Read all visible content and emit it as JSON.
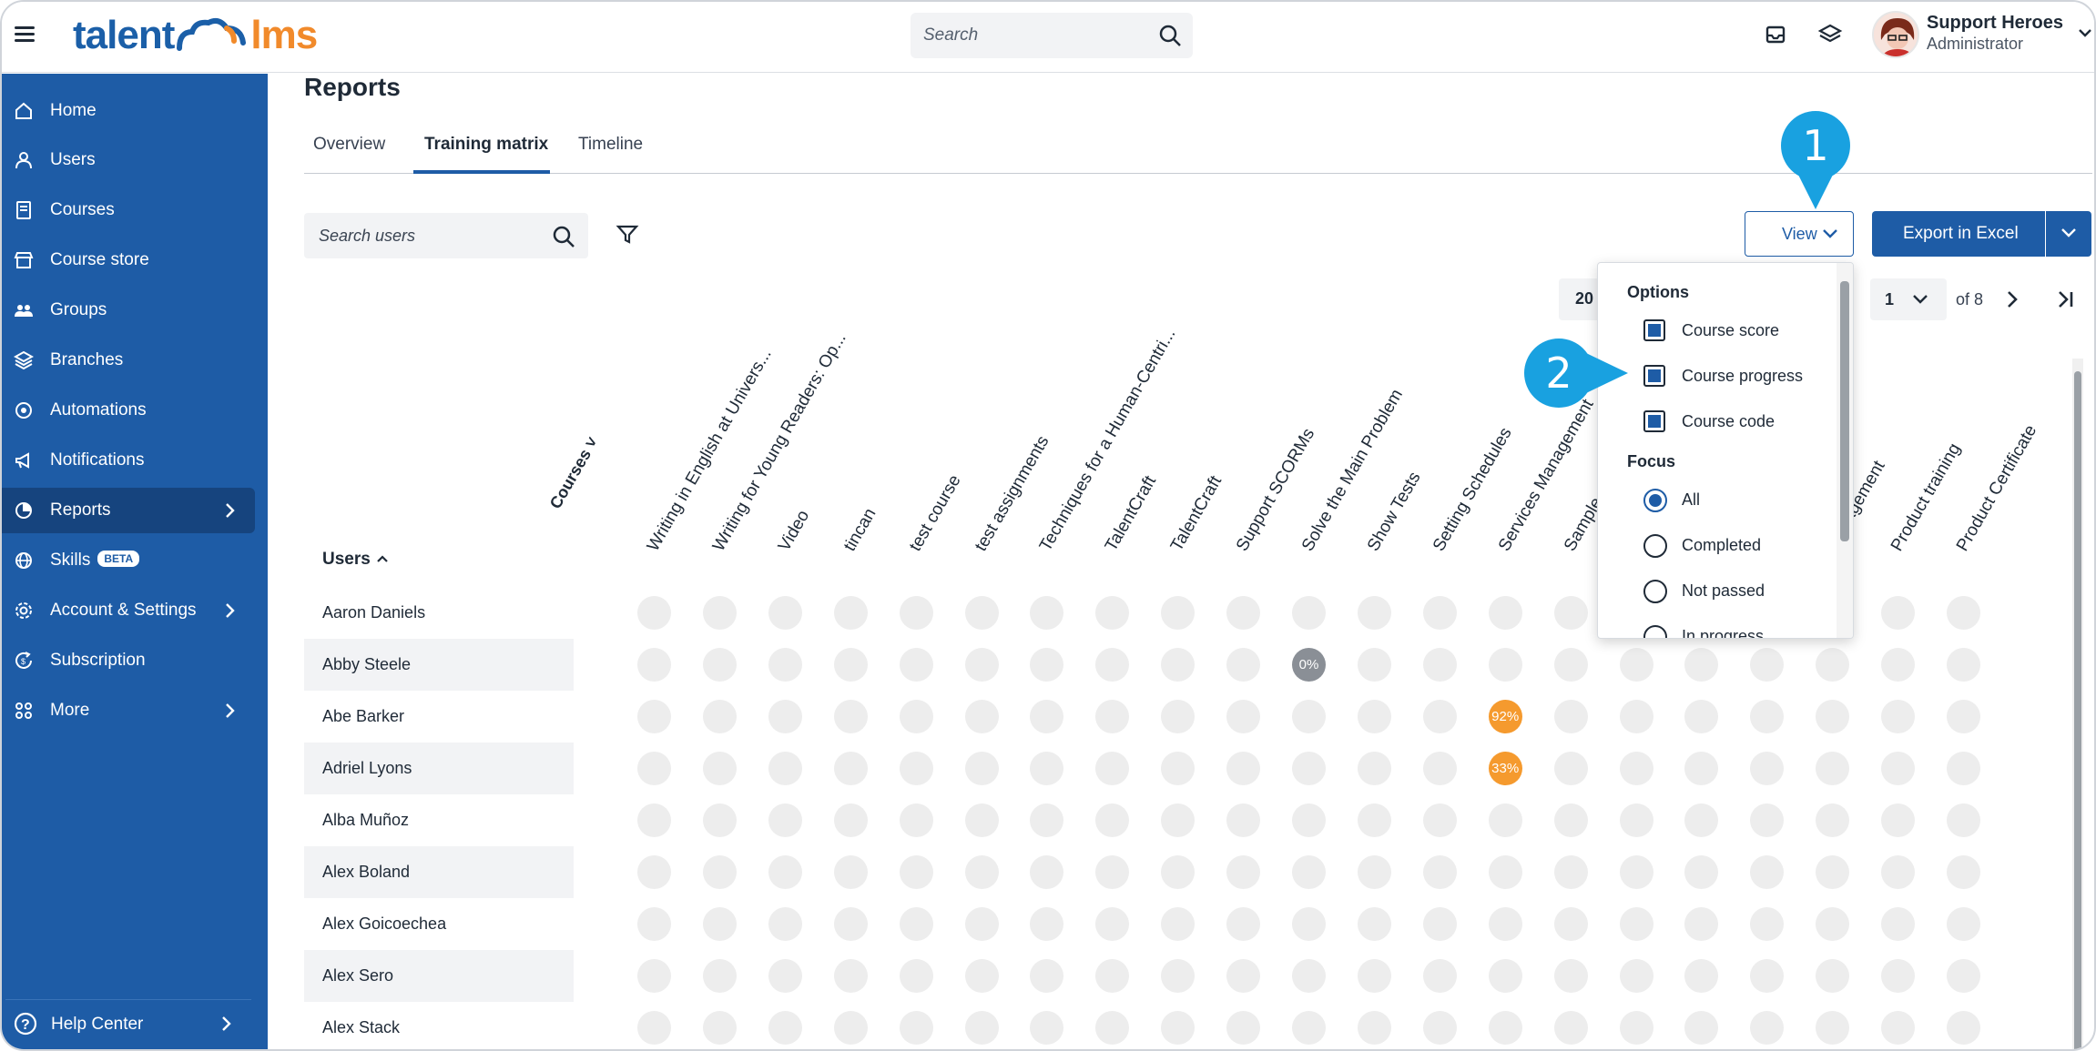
{
  "header": {
    "logo_left": "talent",
    "logo_right": "lms",
    "search_placeholder": "Search",
    "user_name": "Support Heroes",
    "user_role": "Administrator"
  },
  "sidebar": {
    "items": [
      {
        "label": "Home",
        "icon": "home-icon"
      },
      {
        "label": "Users",
        "icon": "user-icon"
      },
      {
        "label": "Courses",
        "icon": "book-icon"
      },
      {
        "label": "Course store",
        "icon": "store-icon"
      },
      {
        "label": "Groups",
        "icon": "groups-icon"
      },
      {
        "label": "Branches",
        "icon": "layers-icon"
      },
      {
        "label": "Automations",
        "icon": "automation-icon"
      },
      {
        "label": "Notifications",
        "icon": "megaphone-icon"
      },
      {
        "label": "Reports",
        "icon": "pie-chart-icon"
      },
      {
        "label": "Skills",
        "icon": "globe-icon"
      },
      {
        "label": "Account & Settings",
        "icon": "gear-icon"
      },
      {
        "label": "Subscription",
        "icon": "subscription-icon"
      },
      {
        "label": "More",
        "icon": "grid-icon"
      }
    ],
    "skills_badge": "BETA",
    "help_label": "Help Center"
  },
  "page": {
    "title": "Reports",
    "tabs": [
      "Overview",
      "Training matrix",
      "Timeline"
    ],
    "active_tab": "Training matrix",
    "search_users_placeholder": "Search users",
    "view_label": "View",
    "export_label": "Export in Excel",
    "per_page": "20",
    "current_page": "1",
    "of_pages": "of 8"
  },
  "matrix": {
    "courses_axis": "Courses",
    "users_header": "Users",
    "courses": [
      "Writing in English at Univers...",
      "Writing for Young Readers: Op...",
      "Video",
      "tincan",
      "test course",
      "test assignments",
      "Techniques for a Human-Centri...",
      "TalentCraft",
      "TalentCraft",
      "Support SCORMs",
      "Solve the Main Problem",
      "Show Tests",
      "Setting Schedules",
      "Services Management",
      "Sample",
      "",
      "",
      "",
      "Management",
      "Product training",
      "Product Certificate"
    ],
    "users": [
      "Aaron Daniels",
      "Abby Steele",
      "Abe Barker",
      "Adriel Lyons",
      "Alba Muñoz",
      "Alex Boland",
      "Alex Goicoechea",
      "Alex Sero",
      "Alex Stack"
    ],
    "highlights": [
      {
        "row": 1,
        "col": 10,
        "text": "0%",
        "color": "#8a8f96"
      },
      {
        "row": 2,
        "col": 13,
        "text": "92%",
        "color": "#f59a2e"
      },
      {
        "row": 3,
        "col": 13,
        "text": "33%",
        "color": "#f59a2e"
      }
    ]
  },
  "view_dropdown": {
    "options_heading": "Options",
    "options": [
      "Course score",
      "Course progress",
      "Course code"
    ],
    "focus_heading": "Focus",
    "focus": [
      "All",
      "Completed",
      "Not passed",
      "In progress"
    ],
    "focus_selected": "All"
  },
  "callouts": [
    "1",
    "2"
  ],
  "colors": {
    "brand_blue": "#1e5ca6",
    "logo_orange": "#f18a2b",
    "callout": "#19a1e0"
  }
}
